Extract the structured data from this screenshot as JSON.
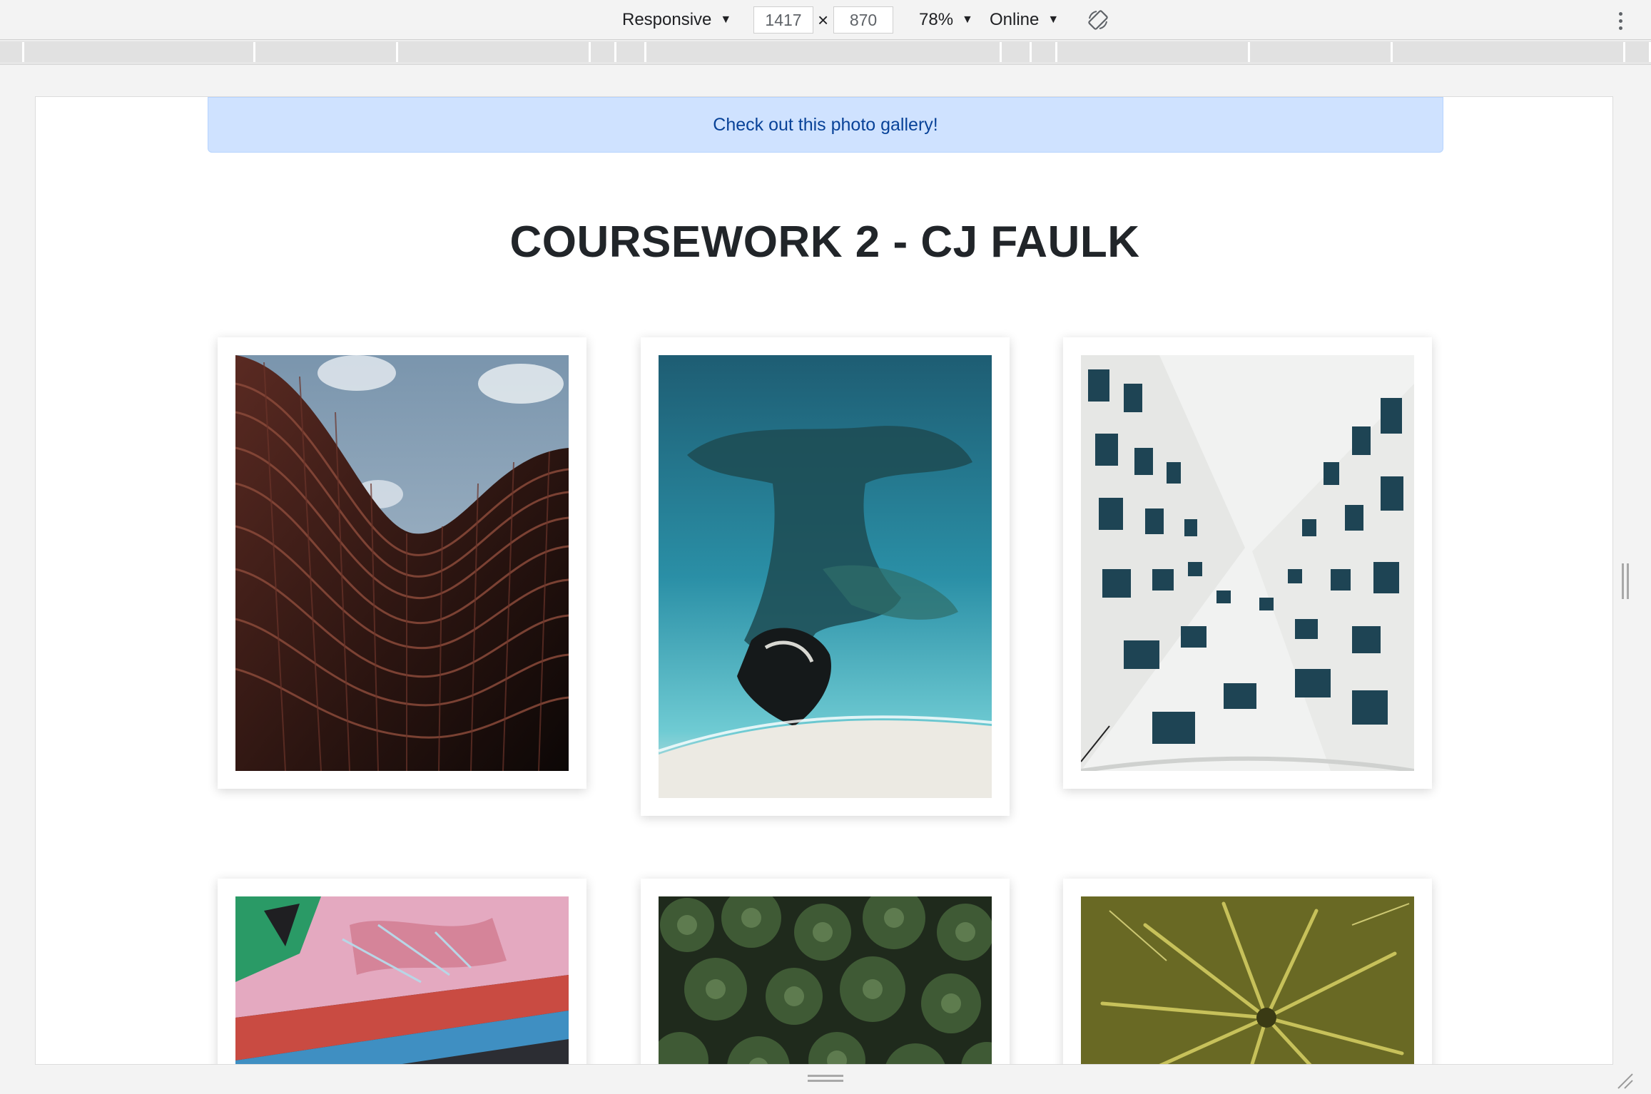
{
  "toolbar": {
    "device_label": "Responsive",
    "width_value": "1417",
    "height_value": "870",
    "times_symbol": "×",
    "zoom_label": "78%",
    "throttle_label": "Online",
    "rotate_icon": "rotate-icon",
    "more_icon": "kebab-menu-icon"
  },
  "alert": {
    "text": "Check out this photo gallery!",
    "bg_color": "#cfe2ff",
    "text_color": "#084298"
  },
  "page": {
    "title": "COURSEWORK 2 - CJ FAULK"
  },
  "gallery": {
    "photos": [
      {
        "subject": "curved building facade against sky"
      },
      {
        "subject": "aerial view of rocky reef and beach"
      },
      {
        "subject": "white building facade looking up"
      },
      {
        "subject": "graffiti wall"
      },
      {
        "subject": "palm trees from above"
      },
      {
        "subject": "single palm tree from above"
      }
    ]
  }
}
